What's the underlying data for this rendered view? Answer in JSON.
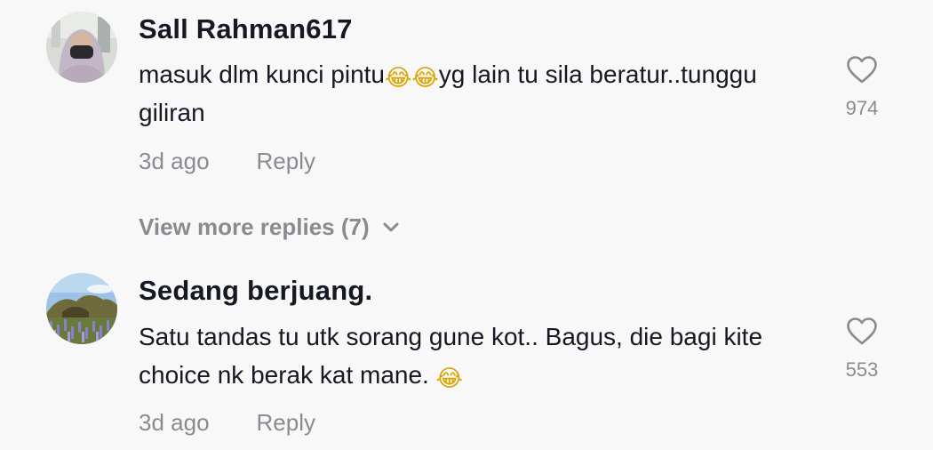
{
  "comments": [
    {
      "username": "Sall Rahman617",
      "text_parts": {
        "before": "masuk dlm kunci pintu",
        "emoji": "😂😂",
        "after": "yg lain tu sila beratur..tunggu giliran"
      },
      "time": "3d ago",
      "reply_label": "Reply",
      "likes": "974",
      "avatar_icon": "avatar-woman-hijab-mask"
    },
    {
      "username": "Sedang berjuang.",
      "text_parts": {
        "before": "Satu tandas tu utk sorang gune kot.. Bagus, die bagi kite choice nk berak kat mane. ",
        "emoji": "😂",
        "after": ""
      },
      "time": "3d ago",
      "reply_label": "Reply",
      "likes": "553",
      "avatar_icon": "avatar-landscape-lupins"
    }
  ],
  "view_more_replies": "View more replies (7)",
  "colors": {
    "background": "#f8f8f8",
    "primary_text": "#161823",
    "secondary_text": "#8a8b91"
  }
}
